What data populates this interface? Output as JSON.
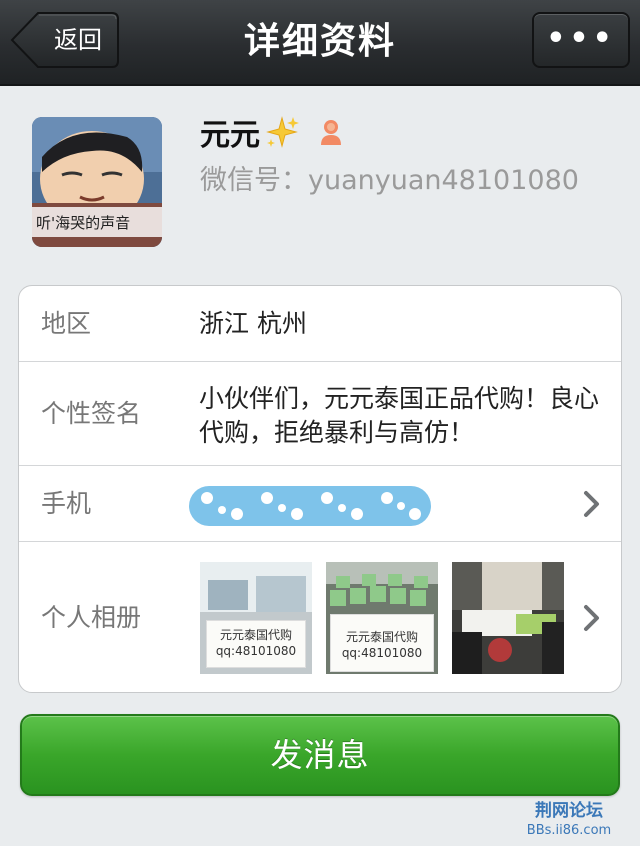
{
  "navbar": {
    "title": "详细资料",
    "back_label": "返回",
    "more_label": "•••"
  },
  "profile": {
    "name": "元元",
    "wechat_id": "微信号：yuanyuan48101080",
    "avatar_caption": "听'海哭的声音",
    "icons": [
      "avatar",
      "sparkle-icon",
      "gender-icon"
    ]
  },
  "info": {
    "region_label": "地区",
    "region_value": "浙江 杭州",
    "signature_label": "个性签名",
    "signature_value": "小伙伴们，元元泰国正品代购！良心代购，拒绝暴利与高仿！",
    "phone_label": "手机",
    "album_label": "个人相册",
    "album_thumbs": [
      {
        "note_line1": "元元泰国代购",
        "note_line2": "qq:48101080"
      },
      {
        "note_line1": "元元泰国代购",
        "note_line2": "qq:48101080"
      },
      {
        "note_line1": "",
        "note_line2": ""
      }
    ]
  },
  "actions": {
    "send_label": "发消息"
  },
  "watermark": {
    "line1": "荆网论坛",
    "line2": "BBs.ii86.com"
  },
  "colors": {
    "navbar": "#2a2d30",
    "background": "#e9ecee",
    "send_button": "#3aa62a",
    "phone_mask": "#7ec3ea",
    "watermark": "#3b78b8"
  }
}
